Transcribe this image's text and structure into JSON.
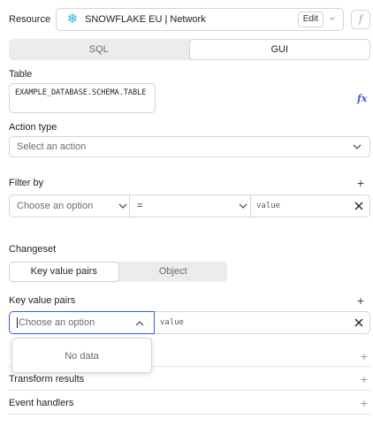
{
  "resource": {
    "label": "Resource",
    "name": "SNOWFLAKE EU | Network",
    "icon": "snowflake-icon",
    "edit_label": "Edit",
    "fx": "f"
  },
  "mode_tabs": [
    {
      "label": "SQL",
      "active": false
    },
    {
      "label": "GUI",
      "active": true
    }
  ],
  "table": {
    "label": "Table",
    "value": "EXAMPLE_DATABASE.SCHEMA.TABLE",
    "fx": "fx"
  },
  "action_type": {
    "label": "Action type",
    "placeholder": "Select an action"
  },
  "filter": {
    "label": "Filter by",
    "column_placeholder": "Choose an option",
    "operator": "=",
    "value_placeholder": "value"
  },
  "changeset": {
    "label": "Changeset",
    "tabs": [
      {
        "label": "Key value pairs",
        "active": true
      },
      {
        "label": "Object",
        "active": false
      }
    ]
  },
  "key_value_pairs": {
    "label": "Key value pairs",
    "key_placeholder": "Choose an option",
    "value_placeholder": "value",
    "dropdown_empty": "No data"
  },
  "sections": [
    {
      "label": "Transform results"
    },
    {
      "label": "Event handlers"
    }
  ],
  "colors": {
    "accent": "#3b5bdb",
    "snowflake": "#29b5e8"
  }
}
